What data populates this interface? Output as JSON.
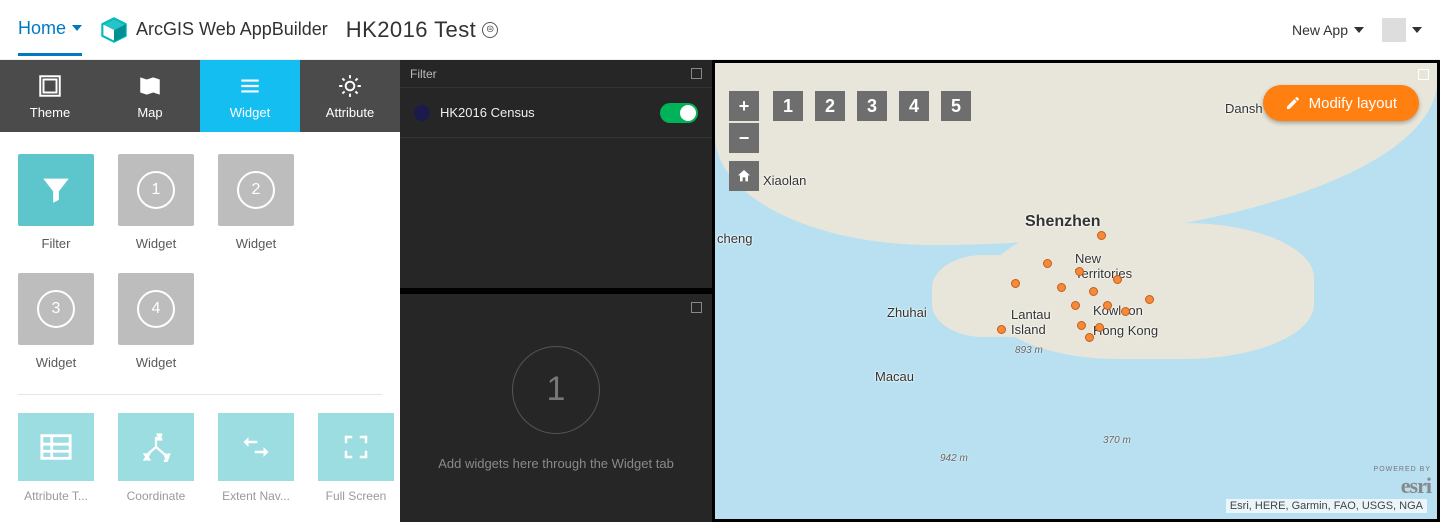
{
  "topbar": {
    "home": "Home",
    "product": "ArcGIS Web AppBuilder",
    "app_title": "HK2016 Test",
    "new_app": "New App"
  },
  "builder_tabs": [
    "Theme",
    "Map",
    "Widget",
    "Attribute"
  ],
  "widgets": {
    "main": [
      {
        "label": "Filter",
        "kind": "filter"
      },
      {
        "label": "Widget",
        "num": "1"
      },
      {
        "label": "Widget",
        "num": "2"
      },
      {
        "label": "Widget",
        "num": "3"
      },
      {
        "label": "Widget",
        "num": "4"
      }
    ],
    "util": [
      {
        "label": "Attribute T..."
      },
      {
        "label": "Coordinate"
      },
      {
        "label": "Extent Nav..."
      },
      {
        "label": "Full Screen"
      }
    ]
  },
  "filter_panel": {
    "title": "Filter",
    "layer_name": "HK2016 Census",
    "toggle_on": true
  },
  "hint_panel": {
    "big_number": "1",
    "message": "Add widgets here through the Widget tab"
  },
  "map": {
    "modify_label": "Modify layout",
    "num_buttons": [
      "1",
      "2",
      "3",
      "4",
      "5"
    ],
    "labels": {
      "shenzhen": "Shenzhen",
      "new_terr": "New\nTerritories",
      "kowloon": "Kowloon",
      "hongkong": "Hong Kong",
      "lantau": "Lantau\nIsland",
      "macau": "Macau",
      "zhuhai": "Zhuhai",
      "xiaolan": "Xiaolan",
      "danshui": "Dansh",
      "cheng": "cheng"
    },
    "dist1": "893 m",
    "dist2": "942 m",
    "dist3": "370 m",
    "attribution": "Esri, HERE, Garmin, FAO, USGS, NGA",
    "esri_pb": "POWERED BY",
    "esri": "esri"
  }
}
